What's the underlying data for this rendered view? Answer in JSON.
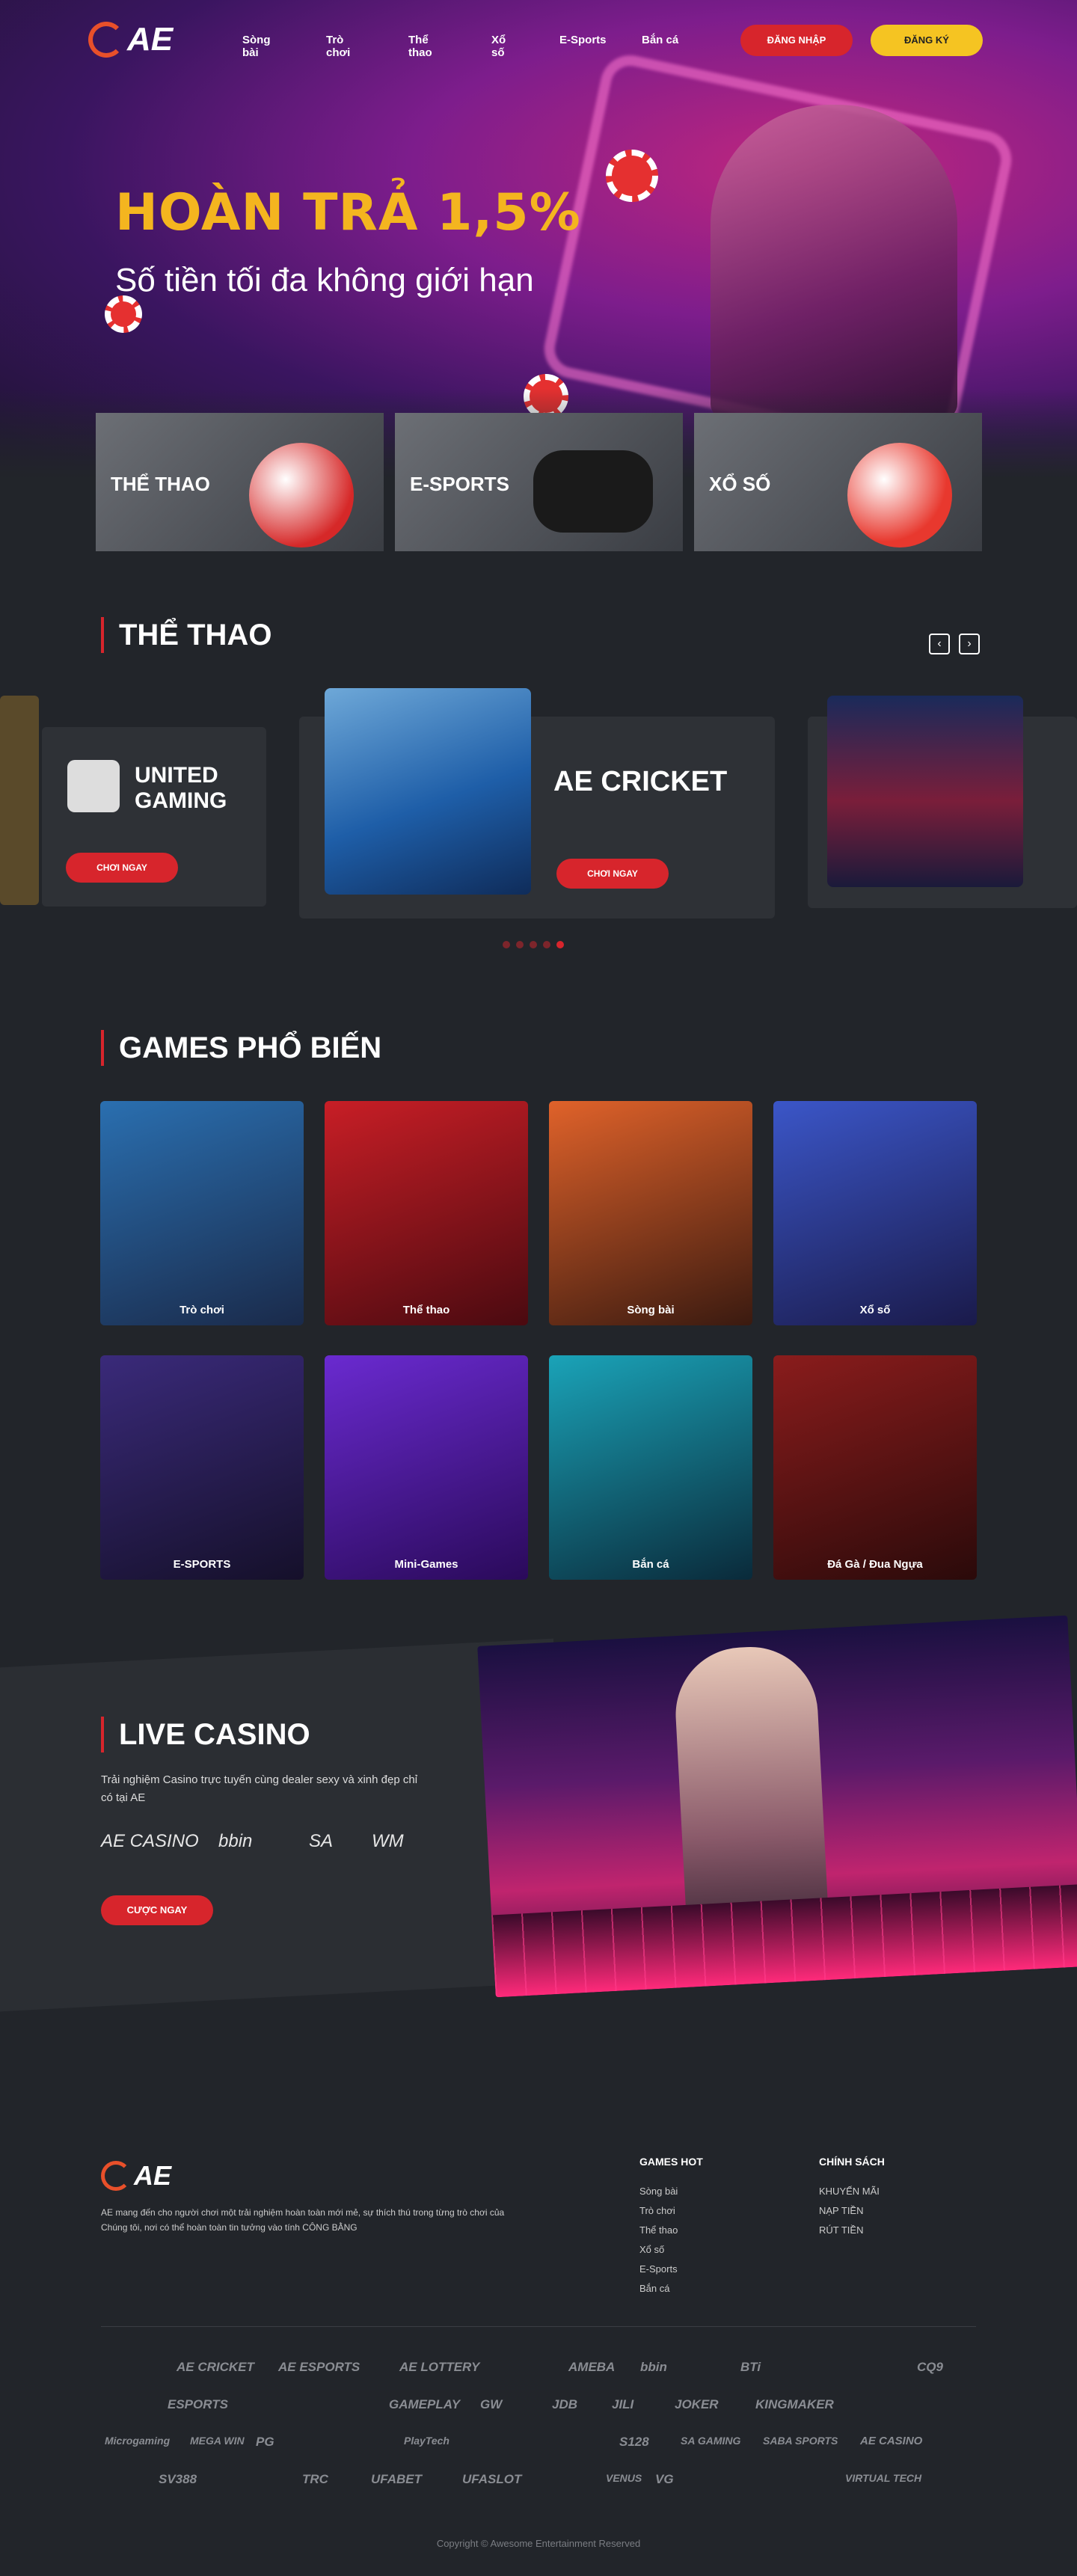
{
  "header": {
    "logo": "AE",
    "nav": [
      "Sòng bài",
      "Trò chơi",
      "Thể thao",
      "Xổ số",
      "E-Sports",
      "Bắn cá"
    ],
    "login": "ĐĂNG NHẬP",
    "register": "ĐĂNG KÝ"
  },
  "hero": {
    "title": "HOÀN TRẢ 1,5%",
    "subtitle": "Số tiền tối đa không giới hạn"
  },
  "categories": [
    "THỂ THAO",
    "E-SPORTS",
    "XỔ SỐ"
  ],
  "sports": {
    "title": "THỂ THAO",
    "slides": [
      {
        "brand": "UNITED GAMING",
        "button": "CHƠI NGAY"
      },
      {
        "brand": "AE CRICKET",
        "button": "CHƠI NGAY"
      }
    ]
  },
  "games": {
    "title": "GAMES PHỔ BIẾN",
    "items": [
      "Trò chơi",
      "Thể thao",
      "Sòng bài",
      "Xổ số",
      "E-SPORTS",
      "Mini-Games",
      "Bắn cá",
      "Đá Gà / Đua Ngựa"
    ],
    "colors": [
      "#2a6fb0",
      "#c81e26",
      "#e0622a",
      "#3b56c8",
      "#3a2a7a",
      "#6a2ad0",
      "#1aa3b8",
      "#8a1c1c"
    ]
  },
  "live": {
    "title": "LIVE CASINO",
    "desc": "Trải nghiệm Casino trực tuyến cùng dealer sexy và xinh đẹp chỉ có tại AE",
    "logos": [
      "AE CASINO",
      "bbin",
      "SA",
      "WM"
    ],
    "button": "CƯỢC NGAY"
  },
  "footer": {
    "logo": "AE",
    "desc": "AE mang đến cho người chơi một trải nghiệm hoàn toàn mới mẻ, sự thích thú trong từng trò chơi của Chúng tôi, nơi có thể hoàn toàn tin tưởng vào tính CÔNG BẰNG",
    "hot_title": "GAMES HOT",
    "hot_links": [
      "Sòng bài",
      "Trò chơi",
      "Thể thao",
      "Xổ số",
      "E-Sports",
      "Bắn cá"
    ],
    "policy_title": "CHÍNH SÁCH",
    "policy_links": [
      "KHUYẾN MÃI",
      "NẠP TIỀN",
      "RÚT TIỀN"
    ],
    "partners": [
      [
        "AE CRICKET",
        "AE ESPORTS",
        "AE LOTTERY",
        "AMEBA",
        "bbin",
        "BTi",
        "CQ9"
      ],
      [
        "ESPORTS",
        "GAMEPLAY",
        "GW",
        "JDB",
        "JILI",
        "JOKER",
        "KINGMAKER"
      ],
      [
        "Microgaming",
        "MEGA WIN",
        "PG",
        "PlayTech",
        "S128",
        "SA GAMING",
        "SABA SPORTS",
        "AE CASINO"
      ],
      [
        "SV388",
        "TRC",
        "UFABET",
        "UFASLOT",
        "VENUS",
        "VG",
        "VIRTUAL TECH"
      ]
    ],
    "copyright": "Copyright © Awesome Entertainment Reserved"
  }
}
